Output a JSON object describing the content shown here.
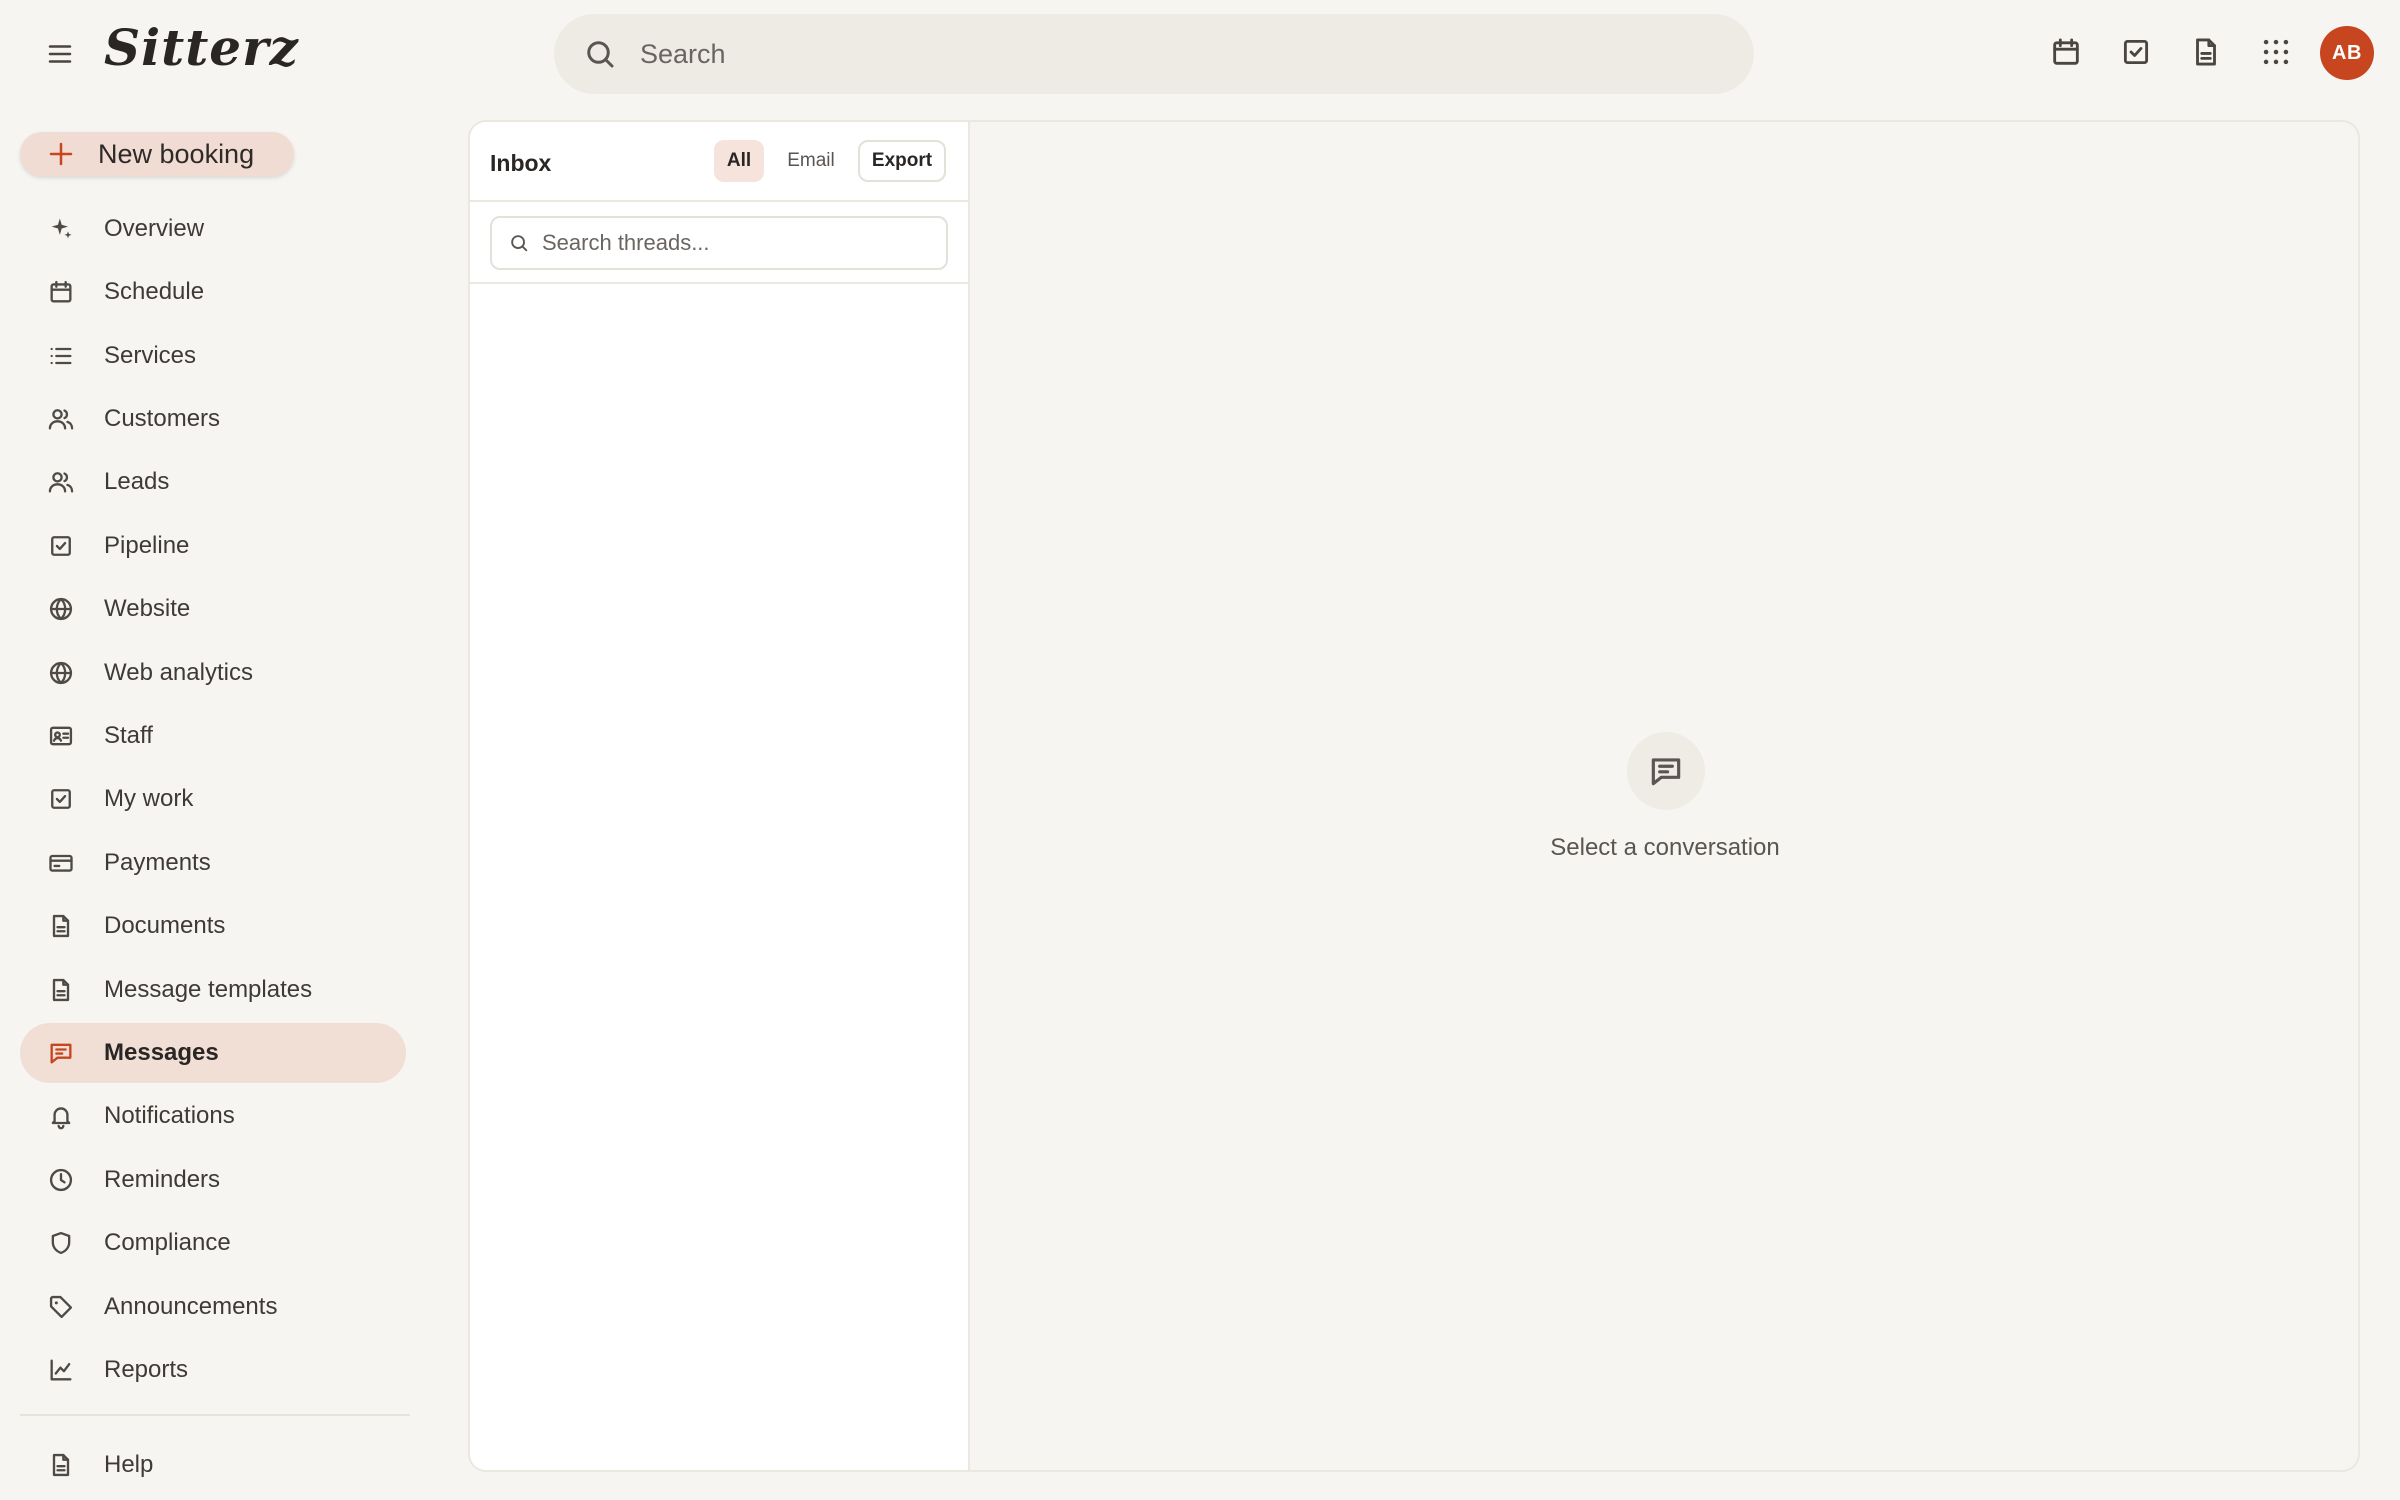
{
  "app": {
    "logo_text": "Sitterz",
    "search_placeholder": "Search",
    "avatar_initials": "AB",
    "accent_color": "#c8461f"
  },
  "top_icons": [
    "calendar-icon",
    "check-square-icon",
    "document-icon",
    "apps-grid-icon"
  ],
  "sidebar": {
    "new_booking_label": "New booking",
    "items": [
      {
        "label": "Overview",
        "icon": "sparkle-icon"
      },
      {
        "label": "Schedule",
        "icon": "calendar-icon"
      },
      {
        "label": "Services",
        "icon": "list-icon"
      },
      {
        "label": "Customers",
        "icon": "users-icon"
      },
      {
        "label": "Leads",
        "icon": "users-icon"
      },
      {
        "label": "Pipeline",
        "icon": "check-square-icon"
      },
      {
        "label": "Website",
        "icon": "globe-icon"
      },
      {
        "label": "Web analytics",
        "icon": "globe-icon"
      },
      {
        "label": "Staff",
        "icon": "id-card-icon"
      },
      {
        "label": "My work",
        "icon": "check-square-icon"
      },
      {
        "label": "Payments",
        "icon": "credit-card-icon"
      },
      {
        "label": "Documents",
        "icon": "document-icon"
      },
      {
        "label": "Message templates",
        "icon": "document-icon"
      },
      {
        "label": "Messages",
        "icon": "message-icon",
        "active": true
      },
      {
        "label": "Notifications",
        "icon": "bell-icon"
      },
      {
        "label": "Reminders",
        "icon": "clock-icon"
      },
      {
        "label": "Compliance",
        "icon": "shield-icon"
      },
      {
        "label": "Announcements",
        "icon": "tag-icon"
      },
      {
        "label": "Reports",
        "icon": "chart-icon"
      }
    ],
    "help_label": "Help"
  },
  "inbox": {
    "title": "Inbox",
    "filter_all": "All",
    "filter_email": "Email",
    "export_label": "Export",
    "search_placeholder": "Search threads..."
  },
  "conversation": {
    "empty_text": "Select a conversation"
  }
}
